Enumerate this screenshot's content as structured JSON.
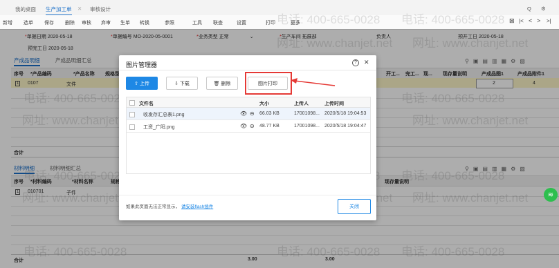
{
  "tabs": {
    "desktop": "我的桌面",
    "production": "生产加工单",
    "close": "✕",
    "approval": "审核设计"
  },
  "window_controls": {
    "search": "Q",
    "settings": "⚙"
  },
  "toolbar": {
    "items": [
      "新增",
      "选单",
      "保存",
      "删除",
      "审核",
      "弃审",
      "生单",
      "转换",
      "参照",
      "工具",
      "联查",
      "设置",
      "打印",
      "更多"
    ],
    "nav": [
      "⊠",
      "|<",
      "<",
      ">",
      ">|"
    ]
  },
  "form": {
    "doc_date_label": "单据日期",
    "doc_date": "2020-05-18",
    "doc_no_label": "单据编号",
    "doc_no": "MO-2020-05-0001",
    "biz_type_label": "业务类型",
    "biz_type": "正常",
    "prod_dept_label": "生产车间",
    "prod_dept": "拓展部",
    "person_label": "负责人",
    "plan_start_label": "预开工日",
    "plan_start": "2020-05-18",
    "plan_end_label": "预完工日",
    "plan_end": "2020-05-18"
  },
  "product_section": {
    "tab1": "产成品明细",
    "tab2": "产成品明细汇总",
    "headers": [
      "序号",
      "*产品编码",
      "*产品名称",
      "规格型号",
      "开工...",
      "完工...",
      "现...",
      "现存量说明",
      "产成品图1",
      "产成品附件1"
    ],
    "row": {
      "no": "1",
      "code": "0107",
      "name": "文件",
      "img": "2",
      "att": "4"
    },
    "total_label": "合计"
  },
  "material_section": {
    "tab1": "材料明细",
    "tab2": "材料明细汇总",
    "headers": [
      "序号",
      "*材料编码",
      "*材料名称",
      "规格",
      "现存量说明"
    ],
    "row": {
      "no": "1",
      "code": "010701",
      "name": "子件"
    },
    "total_label": "合计",
    "total_a": "3.00",
    "total_b": "3.00"
  },
  "watermark": {
    "phone": "电话: 400-665-0028",
    "site": "网址: www.chanjet.net"
  },
  "dialog": {
    "title": "图片管理器",
    "help": "?",
    "close": "✕",
    "buttons": {
      "upload": "上传",
      "download": "下载",
      "delete": "删除",
      "print": "图片打印"
    },
    "columns": [
      "文件名",
      "大小",
      "上传人",
      "上传时间"
    ],
    "files": [
      {
        "name": "收发存汇总表1.png",
        "size": "66.03 KB",
        "uploader": "17001098...",
        "time": "2020/5/18 19:04:53"
      },
      {
        "name": "工资_广阳.png",
        "size": "48.77 KB",
        "uploader": "17001098...",
        "time": "2020/5/18 19:04:47"
      }
    ],
    "hint": "如果此页面无法正常显示，",
    "hint_link": "请安装flash插件",
    "close_btn": "关闭"
  },
  "colors": {
    "accent": "#1e88e5",
    "highlight": "#e53935"
  }
}
